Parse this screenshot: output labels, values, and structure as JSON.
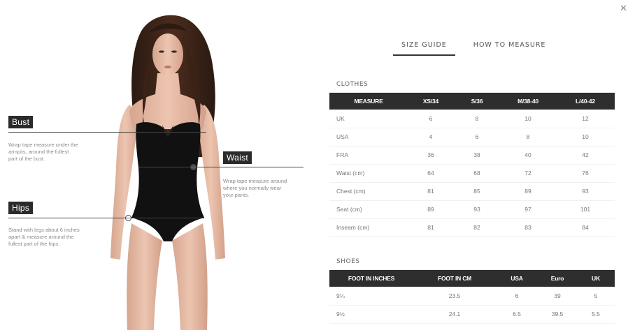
{
  "tabs": {
    "size_guide": "SIZE GUIDE",
    "how_to_measure": "HOW TO MEASURE"
  },
  "close_icon": "close-icon",
  "measures": {
    "bust": {
      "label": "Bust",
      "desc": [
        "Wrap tape measure under the",
        "armpits, around the fullest",
        "part of the bust."
      ]
    },
    "waist": {
      "label": "Waist",
      "desc": [
        "Wrap tape measure around",
        "where you normally wear",
        "your pants."
      ]
    },
    "hips": {
      "label": "Hips",
      "desc": [
        "Stand with legs about 6 inches",
        "apart & measure around the",
        "fullest part of the hips."
      ]
    }
  },
  "clothes": {
    "title": "CLOTHES",
    "headers": [
      "MEASURE",
      "XS/34",
      "S/36",
      "M/38-40",
      "L/40-42"
    ],
    "rows": [
      [
        "UK",
        "6",
        "8",
        "10",
        "12"
      ],
      [
        "USA",
        "4",
        "6",
        "8",
        "10"
      ],
      [
        "FRA",
        "36",
        "38",
        "40",
        "42"
      ],
      [
        "Waist (cm)",
        "64",
        "68",
        "72",
        "76"
      ],
      [
        "Chest (cm)",
        "81",
        "85",
        "89",
        "93"
      ],
      [
        "Seat (cm)",
        "89",
        "93",
        "97",
        "101"
      ],
      [
        "Inseam (cm)",
        "81",
        "82",
        "83",
        "84"
      ]
    ]
  },
  "shoes": {
    "title": "SHOES",
    "headers": [
      "FOOT IN INCHES",
      "FOOT IN CM",
      "USA",
      "Euro",
      "UK"
    ],
    "rows": [
      [
        "9¼",
        "23.5",
        "6",
        "39",
        "5"
      ],
      [
        "9½",
        "24.1",
        "6.5",
        "39.5",
        "5.5"
      ]
    ]
  }
}
